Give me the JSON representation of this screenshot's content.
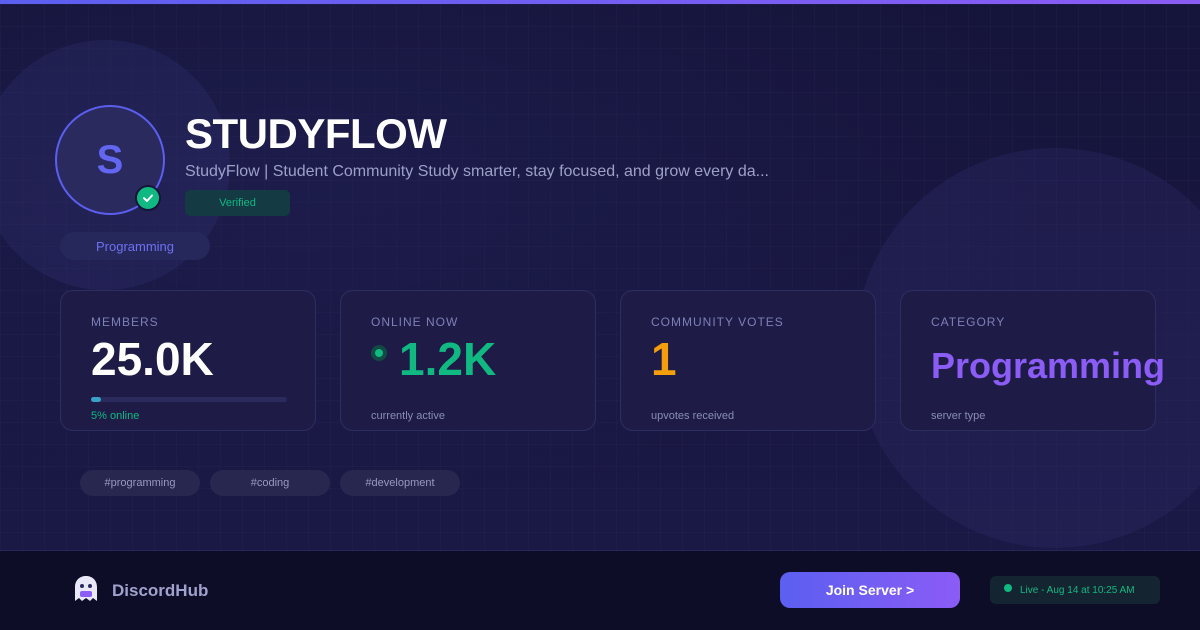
{
  "server": {
    "initial": "S",
    "name": "STUDYFLOW",
    "description": "StudyFlow | Student Community Study smarter, stay focused, and grow every da...",
    "verified_label": "Verified",
    "category_pill": "Programming"
  },
  "stats": {
    "members": {
      "label": "MEMBERS",
      "value": "25.0K",
      "sub": "5% online",
      "online_fraction": 0.05
    },
    "online": {
      "label": "ONLINE NOW",
      "value": "1.2K",
      "sub": "currently active"
    },
    "votes": {
      "label": "COMMUNITY VOTES",
      "value": "1",
      "sub": "upvotes received"
    },
    "category": {
      "label": "CATEGORY",
      "value": "Programming",
      "sub": "server type"
    }
  },
  "tags": [
    "#programming",
    "#coding",
    "#development"
  ],
  "footer": {
    "brand": "DiscordHub",
    "join_label": "Join Server >",
    "live_text": "Live - Aug 14 at 10:25 AM"
  },
  "colors": {
    "accent": "#5b5ff0",
    "accent_purple": "#8b5cf6",
    "online_green": "#10b981",
    "votes_orange": "#f59e0b",
    "category_purple": "#8b5cf6"
  },
  "icons": {
    "verified": "check-circle-icon",
    "online": "status-dot-icon",
    "brand": "ghost-mascot-icon"
  }
}
